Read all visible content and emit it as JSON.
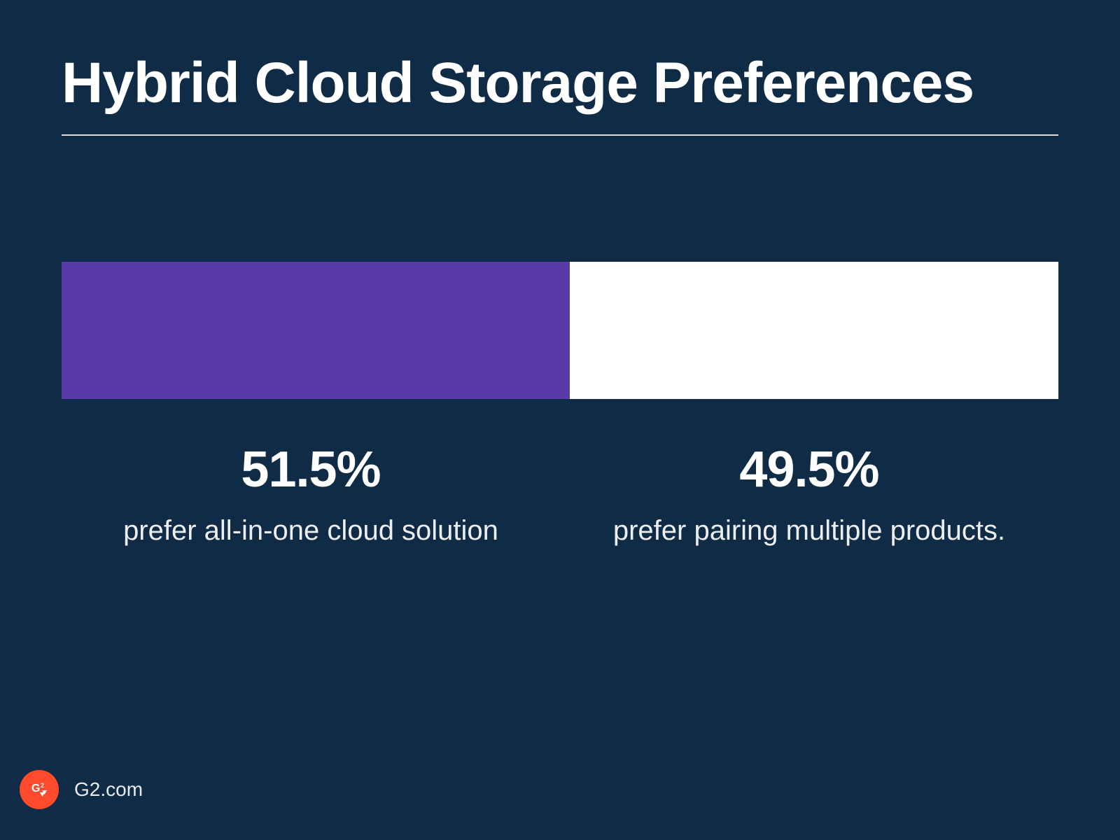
{
  "title": "Hybrid Cloud Storage Preferences",
  "chart_data": {
    "type": "bar",
    "orientation": "horizontal-stacked",
    "title": "Hybrid Cloud Storage Preferences",
    "categories": [
      "prefer all-in-one cloud solution",
      "prefer pairing multiple products."
    ],
    "values": [
      51.5,
      49.5
    ],
    "series": [
      {
        "name": "prefer all-in-one cloud solution",
        "value": 51.5,
        "color": "#5a3aa8"
      },
      {
        "name": "prefer pairing multiple products.",
        "value": 49.5,
        "color": "#ffffff"
      }
    ],
    "xlabel": "",
    "ylabel": "",
    "unit": "%"
  },
  "labels": {
    "left_pct": "51.5%",
    "left_desc": "prefer all-in-one cloud solution",
    "right_pct": "49.5%",
    "right_desc": "prefer pairing multiple products."
  },
  "footer": {
    "source": "G2.com",
    "icon_name": "g2-logo"
  },
  "colors": {
    "background": "#0f2b46",
    "segment_left": "#5a3aa8",
    "segment_right": "#ffffff",
    "accent": "#ff4a2b"
  }
}
